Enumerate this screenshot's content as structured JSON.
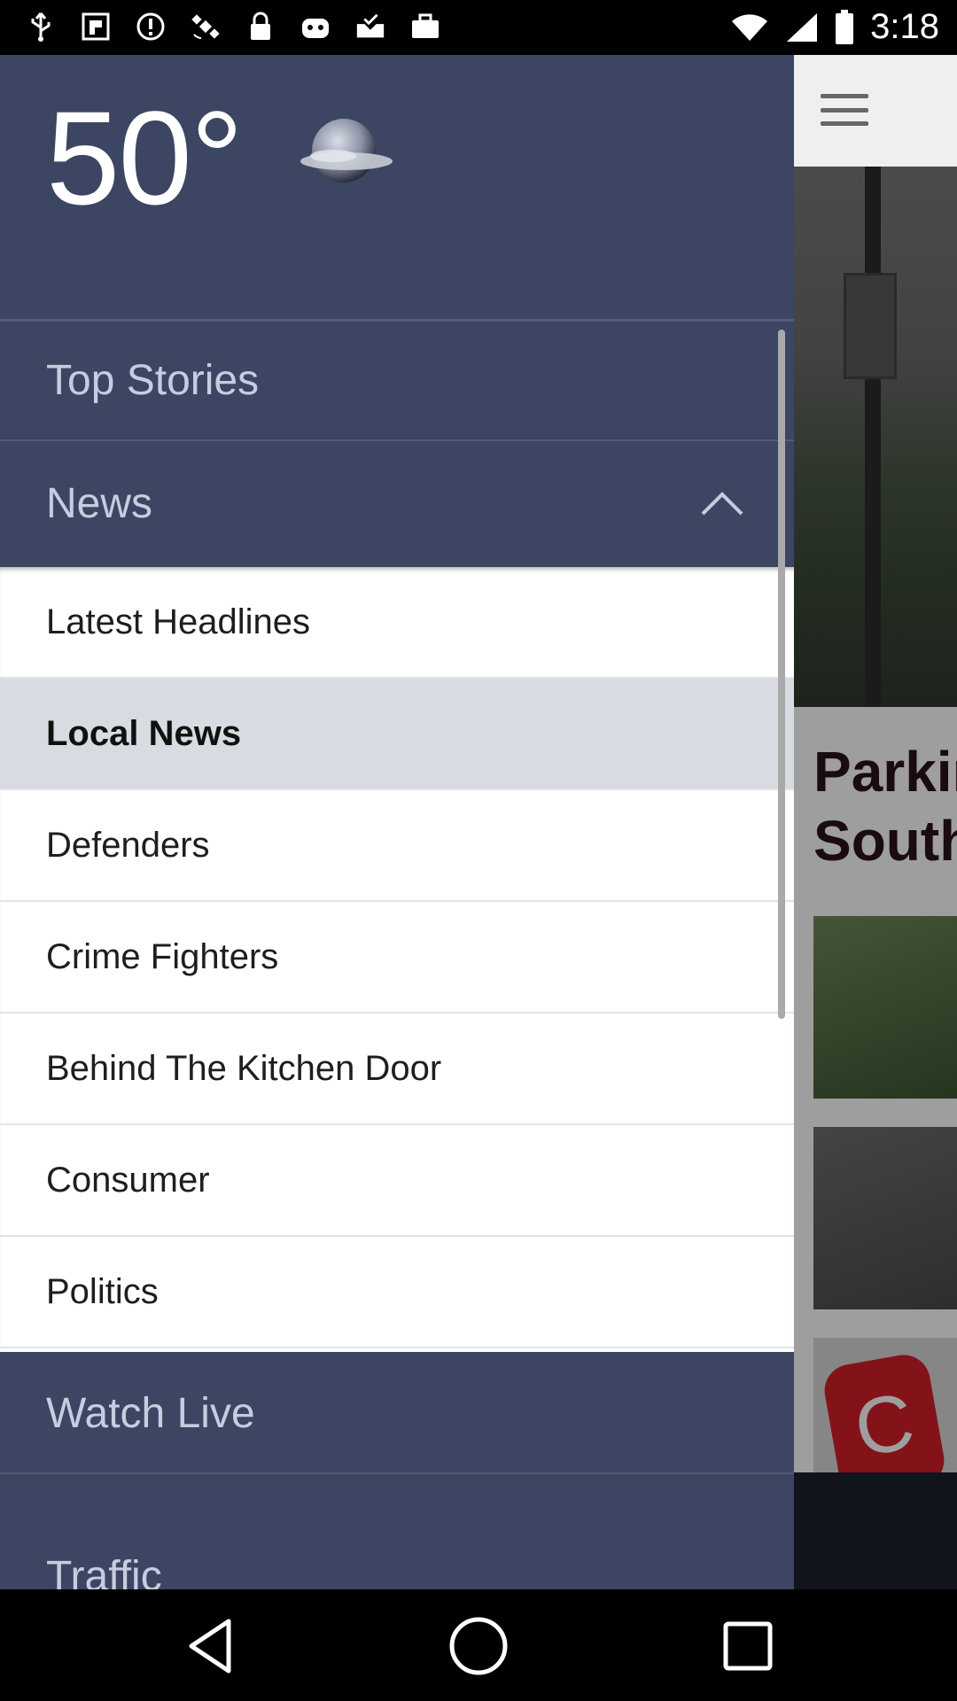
{
  "status_bar": {
    "time": "3:18",
    "icons": [
      "usb-icon",
      "fake-gps-icon",
      "alert-icon",
      "satellite-icon",
      "lock-icon",
      "robot-icon",
      "download-check-icon",
      "briefcase-icon"
    ]
  },
  "weather": {
    "temperature": "50°",
    "condition_icon": "cloudy-moon-icon"
  },
  "nav": {
    "top_stories": "Top Stories",
    "news": "News",
    "watch_live": "Watch Live",
    "traffic": "Traffic"
  },
  "submenu": {
    "items": [
      {
        "label": "Latest Headlines",
        "active": false
      },
      {
        "label": "Local News",
        "active": true
      },
      {
        "label": "Defenders",
        "active": false
      },
      {
        "label": "Crime Fighters",
        "active": false
      },
      {
        "label": "Behind The Kitchen Door",
        "active": false
      },
      {
        "label": "Consumer",
        "active": false
      },
      {
        "label": "Politics",
        "active": false
      }
    ]
  },
  "background": {
    "headline_line1": "Parkin",
    "headline_line2": "South"
  },
  "colors": {
    "drawer_bg": "#3c4561",
    "submenu_bg": "#ffffff",
    "active_item_bg": "#d8dbe1",
    "nav_text": "#c7cce0"
  }
}
